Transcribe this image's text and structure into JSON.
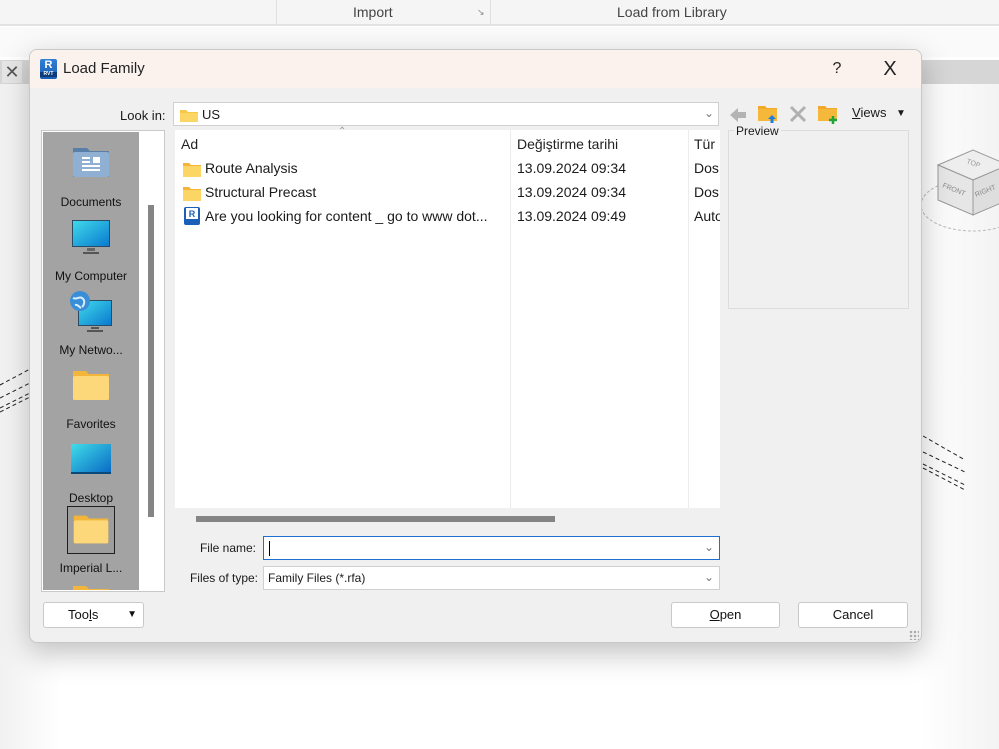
{
  "ribbon": {
    "import_label": "Import",
    "load_from_library_label": "Load from Library"
  },
  "viewcube": {
    "top": "TOP",
    "front": "FRONT",
    "right": "RIGHT"
  },
  "dialog": {
    "title": "Load Family",
    "help_label": "?",
    "close_label": "X",
    "look_in_label": "Look in:",
    "look_in_value": "US",
    "toolbar": {
      "back_icon": "back-arrow-icon",
      "up_icon": "up-one-level-folder-icon",
      "delete_icon": "delete-icon",
      "new_folder_icon": "new-folder-icon",
      "views_label": "Views",
      "views_mnemonic": "V",
      "views_rest": "iews"
    },
    "places": [
      {
        "label": "Documents",
        "icon": "documents-icon"
      },
      {
        "label": "My Computer",
        "icon": "computer-icon"
      },
      {
        "label": "My Netwo...",
        "icon": "network-icon"
      },
      {
        "label": "Favorites",
        "icon": "folder-icon"
      },
      {
        "label": "Desktop",
        "icon": "desktop-icon"
      },
      {
        "label": "Imperial L...",
        "icon": "folder-icon",
        "selected": true
      }
    ],
    "file_list": {
      "columns": [
        "Ad",
        "Değiştirme tarihi",
        "Tür"
      ],
      "rows": [
        {
          "name": "Route Analysis",
          "modified": "13.09.2024 09:34",
          "type": "Dos",
          "icon": "folder-icon"
        },
        {
          "name": "Structural Precast",
          "modified": "13.09.2024 09:34",
          "type": "Dos",
          "icon": "folder-icon"
        },
        {
          "name": "Are you looking for content _ go to www dot...",
          "modified": "13.09.2024 09:49",
          "type": "Auto",
          "icon": "revit-file-icon"
        }
      ]
    },
    "preview_label": "Preview",
    "file_name_label": "File name:",
    "file_name_value": "",
    "files_of_type_label": "Files of type:",
    "files_of_type_value": "Family Files (*.rfa)",
    "tools_label_pre": "Too",
    "tools_label_mn": "l",
    "tools_label_post": "s",
    "open_label_mn": "O",
    "open_label_rest": "pen",
    "cancel_label": "Cancel"
  }
}
